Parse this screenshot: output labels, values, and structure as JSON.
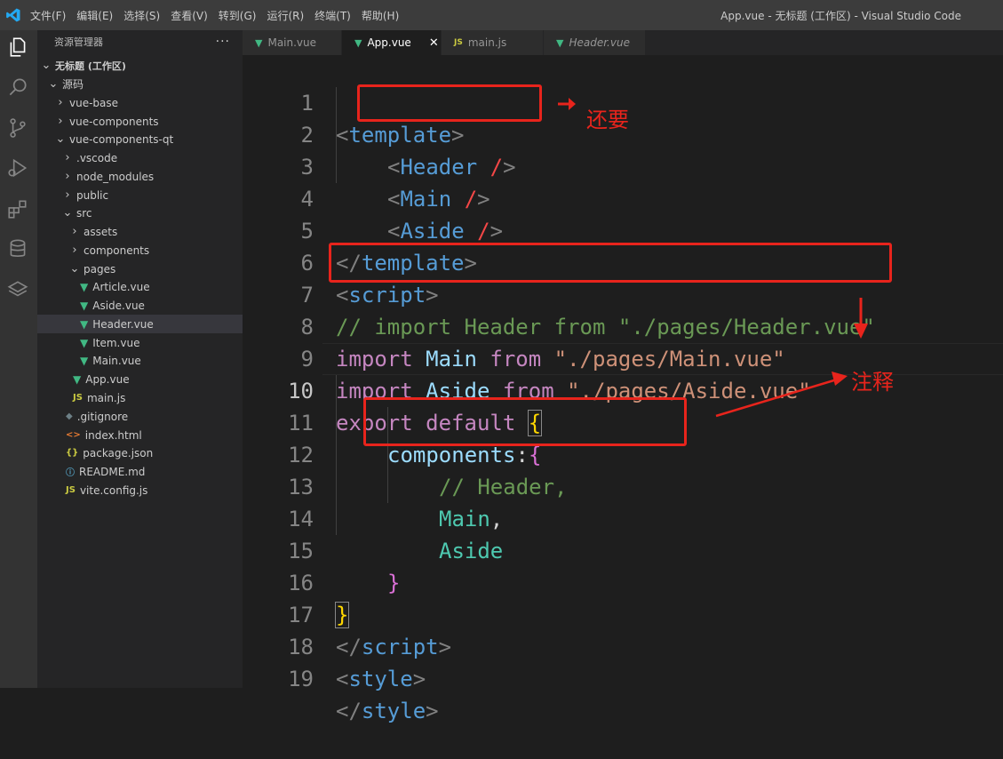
{
  "titlebar": {
    "menu": [
      "文件(F)",
      "编辑(E)",
      "选择(S)",
      "查看(V)",
      "转到(G)",
      "运行(R)",
      "终端(T)",
      "帮助(H)"
    ],
    "window_title": "App.vue - 无标题 (工作区) - Visual Studio Code"
  },
  "activitybar": {
    "icons": [
      "explorer-icon",
      "search-icon",
      "source-control-icon",
      "run-debug-icon",
      "extensions-icon",
      "database-icon",
      "layers-icon"
    ]
  },
  "sidebar": {
    "header": "资源管理器",
    "more": "···",
    "tree": [
      {
        "label": "无标题 (工作区)",
        "type": "workspace",
        "expanded": true
      },
      {
        "label": "源码",
        "type": "folder",
        "expanded": true
      },
      {
        "label": "vue-base",
        "type": "folder",
        "expanded": false
      },
      {
        "label": "vue-components",
        "type": "folder",
        "expanded": false
      },
      {
        "label": "vue-components-qt",
        "type": "folder",
        "expanded": true
      },
      {
        "label": ".vscode",
        "type": "folder",
        "expanded": false
      },
      {
        "label": "node_modules",
        "type": "folder",
        "expanded": false
      },
      {
        "label": "public",
        "type": "folder",
        "expanded": false
      },
      {
        "label": "src",
        "type": "folder",
        "expanded": true
      },
      {
        "label": "assets",
        "type": "folder",
        "expanded": false
      },
      {
        "label": "components",
        "type": "folder",
        "expanded": false
      },
      {
        "label": "pages",
        "type": "folder",
        "expanded": true
      },
      {
        "label": "Article.vue",
        "type": "vue"
      },
      {
        "label": "Aside.vue",
        "type": "vue"
      },
      {
        "label": "Header.vue",
        "type": "vue",
        "selected": true
      },
      {
        "label": "Item.vue",
        "type": "vue"
      },
      {
        "label": "Main.vue",
        "type": "vue"
      },
      {
        "label": "App.vue",
        "type": "vue"
      },
      {
        "label": "main.js",
        "type": "js"
      },
      {
        "label": ".gitignore",
        "type": "git"
      },
      {
        "label": "index.html",
        "type": "html"
      },
      {
        "label": "package.json",
        "type": "json"
      },
      {
        "label": "README.md",
        "type": "md"
      },
      {
        "label": "vite.config.js",
        "type": "js"
      }
    ]
  },
  "tabs": [
    {
      "label": "Main.vue",
      "type": "vue",
      "active": false,
      "italic": false
    },
    {
      "label": "App.vue",
      "type": "vue",
      "active": true,
      "italic": false,
      "close": "✕"
    },
    {
      "label": "main.js",
      "type": "js",
      "active": false,
      "italic": false
    },
    {
      "label": "Header.vue",
      "type": "vue",
      "active": false,
      "italic": true
    }
  ],
  "editor": {
    "current_line": 10,
    "line_numbers": [
      "1",
      "2",
      "3",
      "4",
      "5",
      "6",
      "7",
      "8",
      "9",
      "10",
      "11",
      "12",
      "13",
      "14",
      "15",
      "16",
      "17",
      "18",
      "19"
    ],
    "lines": {
      "l1_open": "<",
      "l1_name": "template",
      "l1_close": ">",
      "l2_open": "<",
      "l2_comp": "Header",
      "l2_slash": "/",
      "l2_close": ">",
      "l3_open": "<",
      "l3_comp": "Main",
      "l3_slash": "/",
      "l3_close": ">",
      "l4_open": "<",
      "l4_comp": "Aside",
      "l4_slash": "/",
      "l4_close": ">",
      "l5_open": "</",
      "l5_name": "template",
      "l5_close": ">",
      "l6_open": "<",
      "l6_name": "script",
      "l6_close": ">",
      "l7_comment": "// import Header from \"./pages/Header.vue\"",
      "l8_kw": "import",
      "l8_id": "Main",
      "l8_from": "from",
      "l8_str": "\"./pages/Main.vue\"",
      "l9_kw": "import",
      "l9_id": "Aside",
      "l9_from": "from",
      "l9_str": "\"./pages/Aside.vue\"",
      "l10_kw": "export",
      "l10_def": "default",
      "l10_brace": "{",
      "l11_prop": "components",
      "l11_colon": ":",
      "l11_brace": "{",
      "l12_comment": "// Header,",
      "l13_id": "Main",
      "l13_comma": ",",
      "l14_id": "Aside",
      "l15_brace": "}",
      "l16_brace": "}",
      "l17_open": "</",
      "l17_name": "script",
      "l17_close": ">",
      "l18_open": "<",
      "l18_name": "style",
      "l18_close": ">",
      "l19_open": "</",
      "l19_name": "style",
      "l19_close": ">"
    }
  },
  "annotations": {
    "label_also": "还要",
    "label_comment": "注释"
  },
  "colors": {
    "annotation_red": "#e8241c",
    "vue_green": "#41b883",
    "editor_bg": "#1e1e1e"
  }
}
